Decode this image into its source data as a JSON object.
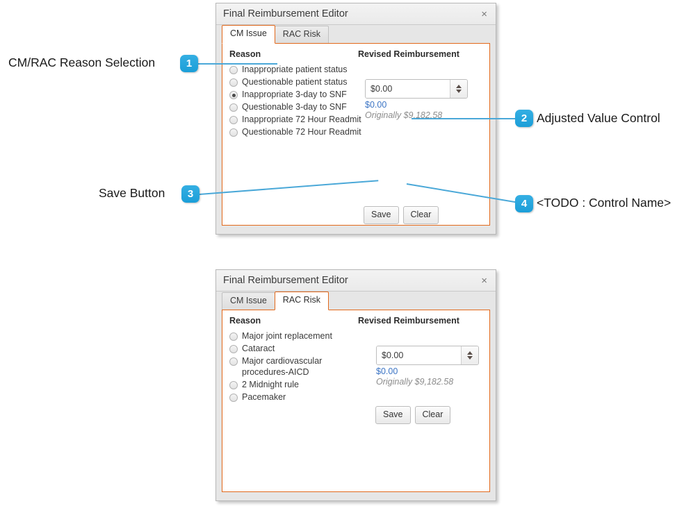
{
  "panels": [
    {
      "title": "Final Reimbursement Editor",
      "close_icon": "×",
      "tabs": [
        {
          "label": "CM Issue",
          "active": true
        },
        {
          "label": "RAC Risk",
          "active": false
        }
      ],
      "headers": {
        "reason": "Reason",
        "revised": "Revised Reimbursement"
      },
      "reasons": [
        {
          "label": "Inappropriate patient status",
          "selected": false
        },
        {
          "label": "Questionable patient status",
          "selected": false
        },
        {
          "label": "Inappropriate 3-day to SNF",
          "selected": true
        },
        {
          "label": "Questionable 3-day to SNF",
          "selected": false
        },
        {
          "label": "Inappropriate 72 Hour Readmit",
          "selected": false
        },
        {
          "label": "Questionable 72 Hour Readmit",
          "selected": false
        }
      ],
      "value_control": {
        "input_value": "$0.00",
        "adjusted_value": "$0.00",
        "original_value": "Originally $9,182.58"
      },
      "buttons": {
        "save": "Save",
        "clear": "Clear"
      }
    },
    {
      "title": "Final Reimbursement Editor",
      "close_icon": "×",
      "tabs": [
        {
          "label": "CM Issue",
          "active": false
        },
        {
          "label": "RAC Risk",
          "active": true
        }
      ],
      "headers": {
        "reason": "Reason",
        "revised": "Revised Reimbursement"
      },
      "reasons": [
        {
          "label": "Major joint replacement",
          "selected": false
        },
        {
          "label": "Cataract",
          "selected": false
        },
        {
          "label": "Major cardiovascular procedures-AICD",
          "selected": false
        },
        {
          "label": "2 Midnight rule",
          "selected": false
        },
        {
          "label": "Pacemaker",
          "selected": false
        }
      ],
      "value_control": {
        "input_value": "$0.00",
        "adjusted_value": "$0.00",
        "original_value": "Originally $9,182.58"
      },
      "buttons": {
        "save": "Save",
        "clear": "Clear"
      }
    }
  ],
  "annotations": [
    {
      "number": "1",
      "label": "CM/RAC Reason Selection"
    },
    {
      "number": "2",
      "label": "Adjusted Value Control"
    },
    {
      "number": "3",
      "label": "Save Button"
    },
    {
      "number": "4",
      "label": "<TODO : Control Name>"
    }
  ],
  "colors": {
    "accent_orange": "#e2681a",
    "badge_blue": "#1b9ed8",
    "leader_blue": "#4aa8d8",
    "adjusted_text": "#3b74c4"
  }
}
